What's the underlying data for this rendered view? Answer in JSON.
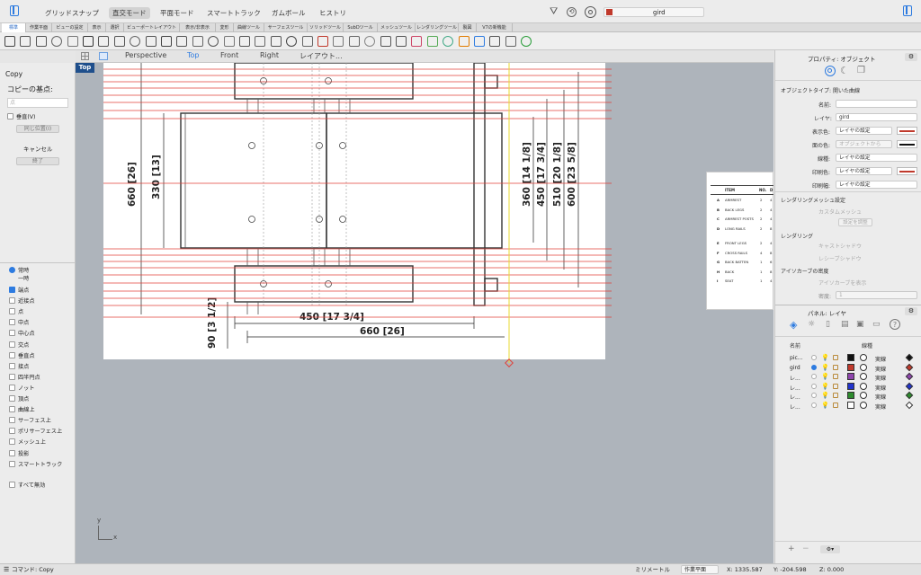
{
  "topbar": {
    "buttons": [
      "グリッドスナップ",
      "直交モード",
      "平面モード",
      "スマートトラック",
      "ガムボール",
      "ヒストリ"
    ],
    "active": "直交モード",
    "layer_name": "gird",
    "layer_color": "#c0392b"
  },
  "tabs": [
    "標準",
    "作業平面",
    "ビューの設定",
    "表示",
    "選択",
    "ビューポートレイアウト",
    "表示/非表示",
    "変形",
    "曲線ツール",
    "サーフェスツール",
    "ソリッドツール",
    "SubDツール",
    "メッシュツール",
    "レンダリングツール",
    "製図",
    "V7の新機能"
  ],
  "viewport_tabs": [
    "Perspective",
    "Top",
    "Front",
    "Right",
    "レイアウト..."
  ],
  "viewport_active": "Top",
  "viewport_label": "Top",
  "left_panel": {
    "command": "Copy",
    "prompt": "コピーの基点:",
    "input_placeholder": "点",
    "vertical_label": "垂直(V)",
    "in_place_label": "同じ位置(I)",
    "cancel_label": "キャンセル",
    "done_label": "終了",
    "radio_persistent": "常時",
    "radio_once": "一時",
    "snaps": [
      "端点",
      "近接点",
      "点",
      "中点",
      "中心点",
      "交点",
      "垂直点",
      "接点",
      "四半円点",
      "ノット",
      "頂点",
      "曲線上",
      "サーフェス上",
      "ポリサーフェス上",
      "メッシュ上",
      "投影",
      "スマートトラック"
    ],
    "snaps_checked": [
      "端点"
    ],
    "disable_all": "すべて無効"
  },
  "drawing": {
    "dims": [
      "660 [26]",
      "330 [13]",
      "360 [14 1/8]",
      "450 [17 3/4]",
      "510 [20 1/8]",
      "600 [23 5/8]",
      "450 [17 3/4]",
      "660 [26]",
      "90 [3 1/2]"
    ],
    "table_headers": [
      "ITEM",
      "NO.",
      "D"
    ],
    "table_rows": [
      {
        "key": "A",
        "name": "ARMREST",
        "no": "2",
        "d": "4"
      },
      {
        "key": "B",
        "name": "BACK LEGS",
        "no": "2",
        "d": "4"
      },
      {
        "key": "C",
        "name": "ARMREST POSTS",
        "no": "2",
        "d": "4"
      },
      {
        "key": "D",
        "name": "LONG RAILS",
        "no": "2",
        "d": "8"
      },
      {
        "key": "E",
        "name": "FRONT LEGS",
        "no": "2",
        "d": "4"
      },
      {
        "key": "F",
        "name": "CROSS RAILS",
        "no": "4",
        "d": "8"
      },
      {
        "key": "G",
        "name": "BACK BATTEN",
        "no": "1",
        "d": "6"
      },
      {
        "key": "H",
        "name": "BACK",
        "no": "1",
        "d": "8"
      },
      {
        "key": "I",
        "name": "SEAT",
        "no": "1",
        "d": "4"
      }
    ],
    "axis_x": "x",
    "axis_y": "y"
  },
  "properties": {
    "title": "プロパティ: オブジェクト",
    "object_type_label": "オブジェクトタイプ:",
    "object_type_value": "開いた曲線",
    "name_label": "名前:",
    "layer_label": "レイヤ:",
    "layer_value": "gird",
    "display_color_label": "表示色:",
    "display_color_value": "レイヤの設定",
    "display_color_swatch": "#c0392b",
    "face_color_label": "面の色:",
    "face_color_value": "オブジェクトから",
    "face_color_swatch": "#111111",
    "linetype_label": "線種:",
    "linetype_value": "レイヤの設定",
    "print_color_label": "印刷色:",
    "print_color_value": "レイヤの設定",
    "print_color_swatch": "#c0392b",
    "print_width_label": "印刷幅:",
    "print_width_value": "レイヤの設定",
    "render_mesh_heading": "レンダリングメッシュ設定",
    "custom_mesh": "カスタムメッシュ",
    "adjust_settings": "設定を調整",
    "rendering_heading": "レンダリング",
    "cast_shadows": "キャストシャドウ",
    "receive_shadows": "レシーブシャドウ",
    "isocurve_heading": "アイソカーブの密度",
    "show_isocurves": "アイソカーブを表示",
    "density_label": "密度:",
    "density_value": "1"
  },
  "layers": {
    "title": "パネル: レイヤ",
    "col_name": "名前",
    "col_linetype": "線種",
    "rows": [
      {
        "name": "pic...",
        "color": "#111111",
        "linetype": "実線",
        "diamond": "#111111",
        "current": false
      },
      {
        "name": "gird",
        "color": "#c0392b",
        "linetype": "実線",
        "diamond": "#c0392b",
        "current": true
      },
      {
        "name": "レ...",
        "color": "#8e44ad",
        "linetype": "実線",
        "diamond": "#8e44ad",
        "current": false
      },
      {
        "name": "レ...",
        "color": "#2233cc",
        "linetype": "実線",
        "diamond": "#2233cc",
        "current": false
      },
      {
        "name": "レ...",
        "color": "#2e8b2e",
        "linetype": "実線",
        "diamond": "#2e8b2e",
        "current": false
      },
      {
        "name": "レ...",
        "color": "#ffffff",
        "linetype": "実線",
        "diamond": "#ffffff",
        "current": false
      }
    ]
  },
  "status": {
    "command": "コマンド: Copy",
    "units": "ミリメートル",
    "cplane": "作業平面",
    "x": "X: 1335.587",
    "y": "Y: -204.598",
    "z": "Z: 0.000"
  }
}
